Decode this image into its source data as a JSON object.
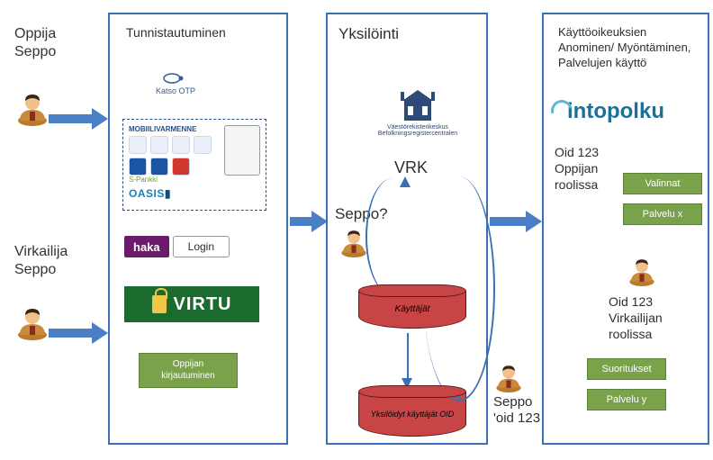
{
  "actors": {
    "learner": {
      "line1": "Oppija",
      "line2": "Seppo"
    },
    "official": {
      "line1": "Virkailija",
      "line2": "Seppo"
    }
  },
  "panels": {
    "auth": {
      "title": "Tunnistautuminen",
      "katso_label": "Katso OTP",
      "bank_header": "MOBIILIVARMENNE",
      "spankki": "S-Pankki",
      "oasis": "OASIS",
      "haka_label": "haka",
      "login_label": "Login",
      "virtu_label": "VIRTU",
      "learner_login_btn": "Oppijan kirjautuminen"
    },
    "ident": {
      "title": "Yksilöinti",
      "vrk_caption": "Väestörekisterikeskus Befolkningsregistercentralen",
      "vrk_label": "VRK",
      "seppo_question": "Seppo?",
      "db_users": "Käyttäjät",
      "db_identified": "Yksilöidyt käyttäjät OID",
      "seppo_id_line1": "Seppo",
      "seppo_id_line2": "'oid 123"
    },
    "rights": {
      "title": "Käyttöoikeuksien Anominen/ Myöntäminen, Palvelujen käyttö",
      "logo_text": "intopolku",
      "role_learner_line1": "Oid 123",
      "role_learner_line2": "Oppijan",
      "role_learner_line3": "roolissa",
      "role_official_line1": "Oid 123",
      "role_official_line2": "Virkailijan",
      "role_official_line3": "roolissa",
      "btn_valinnat": "Valinnat",
      "btn_palvelu_x": "Palvelu  x",
      "btn_suoritukset": "Suoritukset",
      "btn_palvelu_y": "Palvelu  y"
    }
  }
}
